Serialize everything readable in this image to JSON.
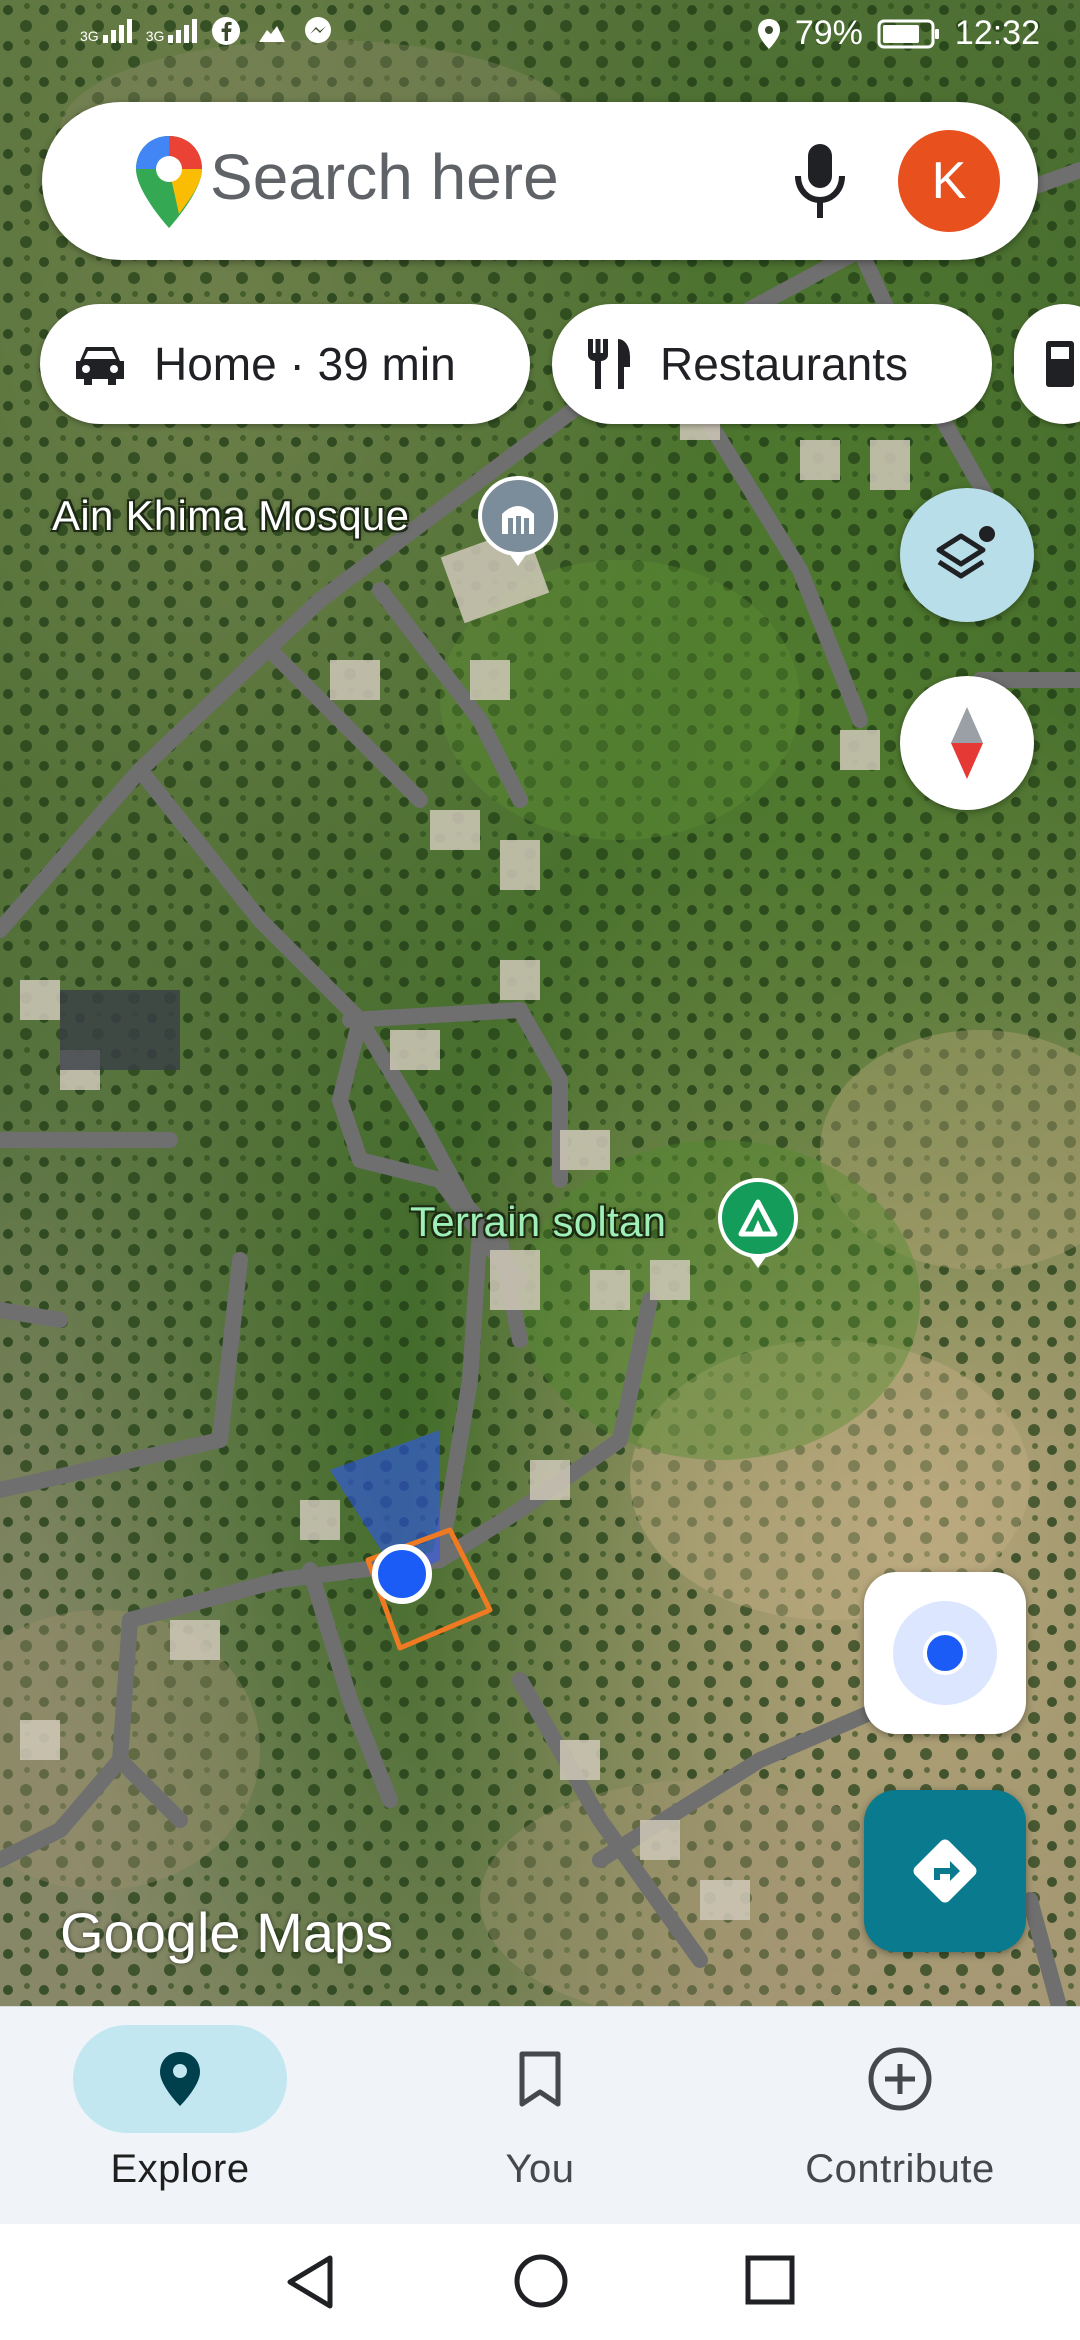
{
  "status_bar": {
    "network_1": "3G",
    "network_2": "3G",
    "battery": "79%",
    "time": "12:32",
    "icons": [
      "facebook-icon",
      "weather-icon",
      "messenger-icon",
      "location-icon",
      "battery-icon"
    ]
  },
  "search": {
    "placeholder": "Search here",
    "avatar_letter": "K",
    "avatar_color": "#e8501e"
  },
  "chips": [
    {
      "label": "Home · 39 min",
      "icon": "car-icon"
    },
    {
      "label": "Restaurants",
      "icon": "restaurant-icon"
    },
    {
      "label": "",
      "icon": "gas-station-icon"
    }
  ],
  "map": {
    "labels": [
      {
        "text": "Ain Khima Mosque",
        "color": "#ffffff",
        "icon": "mosque-icon"
      },
      {
        "text": "Terrain soltan",
        "color": "#9ef0b6",
        "icon": "campground-icon"
      }
    ],
    "logo": "Google Maps"
  },
  "fabs": {
    "layers": "layers-icon",
    "compass": "compass-icon",
    "my_location": "my-location-icon",
    "directions": "directions-icon"
  },
  "bottom_nav": [
    {
      "label": "Explore",
      "icon": "explore-pin-icon",
      "active": true
    },
    {
      "label": "You",
      "icon": "bookmark-icon",
      "active": false
    },
    {
      "label": "Contribute",
      "icon": "add-circle-icon",
      "active": false
    }
  ],
  "colors": {
    "accent": "#0a7a8e",
    "active_nav_bg": "#c2e7f1",
    "location_dot": "#1a5cf5",
    "boundary": "#f07a21"
  }
}
